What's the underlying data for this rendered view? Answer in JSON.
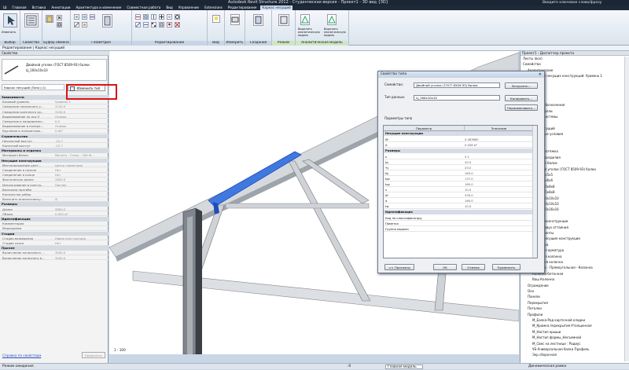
{
  "window": {
    "title": "Autodesk Revit Structure 2012 - Студенческая версия -   Проект1 - 3D вид {3D}",
    "search_placeholder": "Введите ключевое слово/фразу"
  },
  "menu": {
    "items": [
      "Ш",
      "Главная",
      "Вставка",
      "Аннотации",
      "Архитектура и изменение",
      "Совместная работа",
      "Вид",
      "Управление",
      "Extensions",
      "Редактирование",
      "Каркас несущий"
    ]
  },
  "ribbon": {
    "groups": [
      "Выбор",
      "Свойства",
      "Буфер обмена",
      "Геометрия",
      "Редактирование",
      "Вид",
      "Измерить",
      "Создание",
      "Режим",
      "Аналитическая модель"
    ],
    "buttons": {
      "modify": "Изменить",
      "properties": "Свойства",
      "analytics_toggle": "Выделить аналитическую модель",
      "analytics_reset": "Выделить аналитическую модель"
    }
  },
  "context_bar": "Редактирование | Каркас несущий",
  "properties_panel": {
    "title": "Свойства",
    "type_name": "Двойной уголок (ГОСТ 8509-93) балки",
    "type_size": "Ц_160х10х10",
    "instance_selector": "Каркас несущий (Пачк) (1)",
    "edit_type_label": "Изменить тип",
    "sections": [
      {
        "name": "Зависимости",
        "rows": [
          [
            "Базовый уровень",
            "Уровень 1"
          ],
          [
            "Смещение начального у...",
            "3150.0"
          ],
          [
            "Смещение конечного ур...",
            "3150.0"
          ],
          [
            "Выравнивание по оси Z",
            "Осевая"
          ],
          [
            "Смещение в направлени...",
            "0.0"
          ],
          [
            "Выравнивание в попере...",
            "Осевая"
          ],
          [
            "Кручение в поперечном...",
            "0.00°"
          ]
        ]
      },
      {
        "name": "Строительство",
        "rows": [
          [
            "Начальный выступ",
            "-12.7"
          ],
          [
            "Конечный выступ",
            "-12.7"
          ]
        ]
      },
      {
        "name": "Материалы и отделка",
        "rows": [
          [
            "Материал балки",
            "Металл - Сталь - 345 М..."
          ]
        ]
      },
      {
        "name": "Несущие конструкции",
        "rows": [
          [
            "Местоположение цент...",
            "Центр геометрии"
          ],
          [
            "Соединение в начале",
            "Нет"
          ],
          [
            "Соединение в конце",
            "Нет"
          ],
          [
            "Фактическая длина",
            "2800.0"
          ],
          [
            "Использование в констр...",
            "Прочее"
          ],
          [
            "Величина прогиба",
            ""
          ],
          [
            "Количество ребер",
            ""
          ],
          [
            "Включить аналитическу...",
            "☑"
          ]
        ]
      },
      {
        "name": "Размеры",
        "rows": [
          [
            "Длина",
            "2800.0"
          ],
          [
            "Объем",
            "0.020 м³"
          ]
        ]
      },
      {
        "name": "Идентификация",
        "rows": [
          [
            "Комментарии",
            ""
          ],
          [
            "Маркировка",
            ""
          ]
        ]
      },
      {
        "name": "Стадии",
        "rows": [
          [
            "Стадия возведения",
            "Новая конструкция"
          ],
          [
            "Стадия сноса",
            "Нет"
          ]
        ]
      },
      {
        "name": "Прочее",
        "rows": [
          [
            "Вычисление начального ...",
            "3000.0"
          ],
          [
            "Вычисление конечного в...",
            "3000.0"
          ]
        ]
      }
    ],
    "help_link": "Справка по свойствам",
    "apply_label": "Применить"
  },
  "project_browser": {
    "title": "Проект1 - Диспетчер проекта",
    "items": [
      {
        "text": "Листы (все)",
        "indent": 0
      },
      {
        "text": "Семейства",
        "indent": 0
      },
      {
        "text": "Аналитические",
        "indent": 1
      },
      {
        "text": "Аннотации несущих конструкций: Уровень 1",
        "indent": 1
      },
      {
        "text": "Балки",
        "indent": 1
      },
      {
        "text": "Каркасы",
        "indent": 1
      },
      {
        "text": "Колонны",
        "indent": 1
      },
      {
        "text": "Легенды",
        "indent": 1
      },
      {
        "text": "Несущие обозначения",
        "indent": 1
      },
      {
        "text": "Общие модели",
        "indent": 1
      },
      {
        "text": "Профили системы",
        "indent": 1
      },
      {
        "text": "Стены",
        "indent": 1
      },
      {
        "text": "Каркас несущий",
        "indent": 1
      },
      {
        "text": "Бетонные условия",
        "indent": 2
      },
      {
        "text": "Болты",
        "indent": 2
      },
      {
        "text": "Блоки",
        "indent": 2
      },
      {
        "text": "Листы натяжка",
        "indent": 2
      },
      {
        "text": "Металлоизделия",
        "indent": 2
      },
      {
        "text": "Сварной балки",
        "indent": 2
      },
      {
        "text": "Двойной уголок (ГОСТ 8509-93) балки",
        "indent": 2
      },
      {
        "text": "Ц_50х5х5",
        "indent": 3
      },
      {
        "text": "Ц_75х6х6",
        "indent": 3
      },
      {
        "text": "Ц_100х8х8",
        "indent": 3
      },
      {
        "text": "Ц_125х8х8",
        "indent": 3
      },
      {
        "text": "Ц_160х10х10",
        "indent": 3
      },
      {
        "text": "Ц_160х10х10",
        "indent": 3
      },
      {
        "text": "Ц_160х16х16",
        "indent": 3
      },
      {
        "text": "Фермы",
        "indent": 2
      },
      {
        "text": "Металлоконструкции",
        "indent": 2
      },
      {
        "text": "Ферма двух оттаяния",
        "indent": 2
      },
      {
        "text": "Фундаменты",
        "indent": 2
      },
      {
        "text": "Колонны несущие конструкции",
        "indent": 1
      },
      {
        "text": "Арматура",
        "indent": 2
      },
      {
        "text": "Несущая арматура",
        "indent": 2
      },
      {
        "text": "Несущая колонна",
        "indent": 2
      },
      {
        "text": "Бетонная колонна",
        "indent": 2
      },
      {
        "text": "Колонна - Прямоугольная - Колонна",
        "indent": 2
      },
      {
        "text": "Колонна-бетонная",
        "indent": 2
      },
      {
        "text": "Ваш Колонна",
        "indent": 2
      },
      {
        "text": "Ограждение",
        "indent": 1
      },
      {
        "text": "Оси",
        "indent": 1
      },
      {
        "text": "Панели",
        "indent": 1
      },
      {
        "text": "Перекрытия",
        "indent": 1
      },
      {
        "text": "Потолки",
        "indent": 1
      },
      {
        "text": "Профили",
        "indent": 1
      },
      {
        "text": "М_Балка-Род карточной кладки",
        "indent": 2
      },
      {
        "text": "М_Кромка перекрытия-Утолщенная",
        "indent": 2
      },
      {
        "text": "М_Настил крыши",
        "indent": 2
      },
      {
        "text": "М_Настил формы_Несъемной",
        "indent": 2
      },
      {
        "text": "М_Свес на лестнице : Радиус",
        "indent": 2
      },
      {
        "text": "УБ-Универсальная балка Профиль",
        "indent": 2
      },
      {
        "text": "Экр сборочная",
        "indent": 2
      }
    ]
  },
  "canvas": {
    "scale_label": "1 : 100"
  },
  "dialog": {
    "title": "Свойства типа",
    "family_label": "Семейство:",
    "family_value": "Двойной уголок (ГОСТ 8509-93) балки",
    "type_label": "Тип данных:",
    "type_value": "Ц_160х10х10",
    "load_button": "Загрузить...",
    "duplicate_button": "Копировать...",
    "rename_button": "Переименовать...",
    "params_label": "Параметры типа",
    "col_param": "Параметр",
    "col_value": "Значение",
    "sections": [
      {
        "name": "Несущие конструкции",
        "rows": [
          [
            "W",
            "0.483880"
          ],
          [
            "A",
            "0.006 м²"
          ]
        ]
      },
      {
        "name": "Размеры",
        "rows": [
          [
            "к",
            "5.1"
          ],
          [
            "tp",
            "20.0"
          ],
          [
            "Yy",
            "43.0"
          ],
          [
            "Ky",
            "165.0"
          ],
          [
            "tpz",
            "137.0"
          ],
          [
            "tpy",
            "165.0"
          ],
          [
            "s",
            "10.0"
          ],
          [
            "bf",
            "330.0"
          ],
          [
            "d",
            "160.0"
          ],
          [
            "tw",
            "10.0"
          ]
        ]
      },
      {
        "name": "Идентификация",
        "rows": [
          [
            "Код по классификатору",
            ""
          ],
          [
            "Пометка",
            ""
          ],
          [
            "Группа модели",
            ""
          ]
        ]
      }
    ],
    "preview_button": "<< Просмотр",
    "ok_button": "ОК",
    "cancel_button": "Отмена",
    "apply_button": "Применить"
  },
  "status": {
    "left": "Режим ожидания",
    "workset": "Главная модель",
    "dynamic": "Динамическая рамка",
    "zero": ":0"
  },
  "colors": {
    "highlight": "#3f79e0",
    "callout": "#d9141b"
  }
}
